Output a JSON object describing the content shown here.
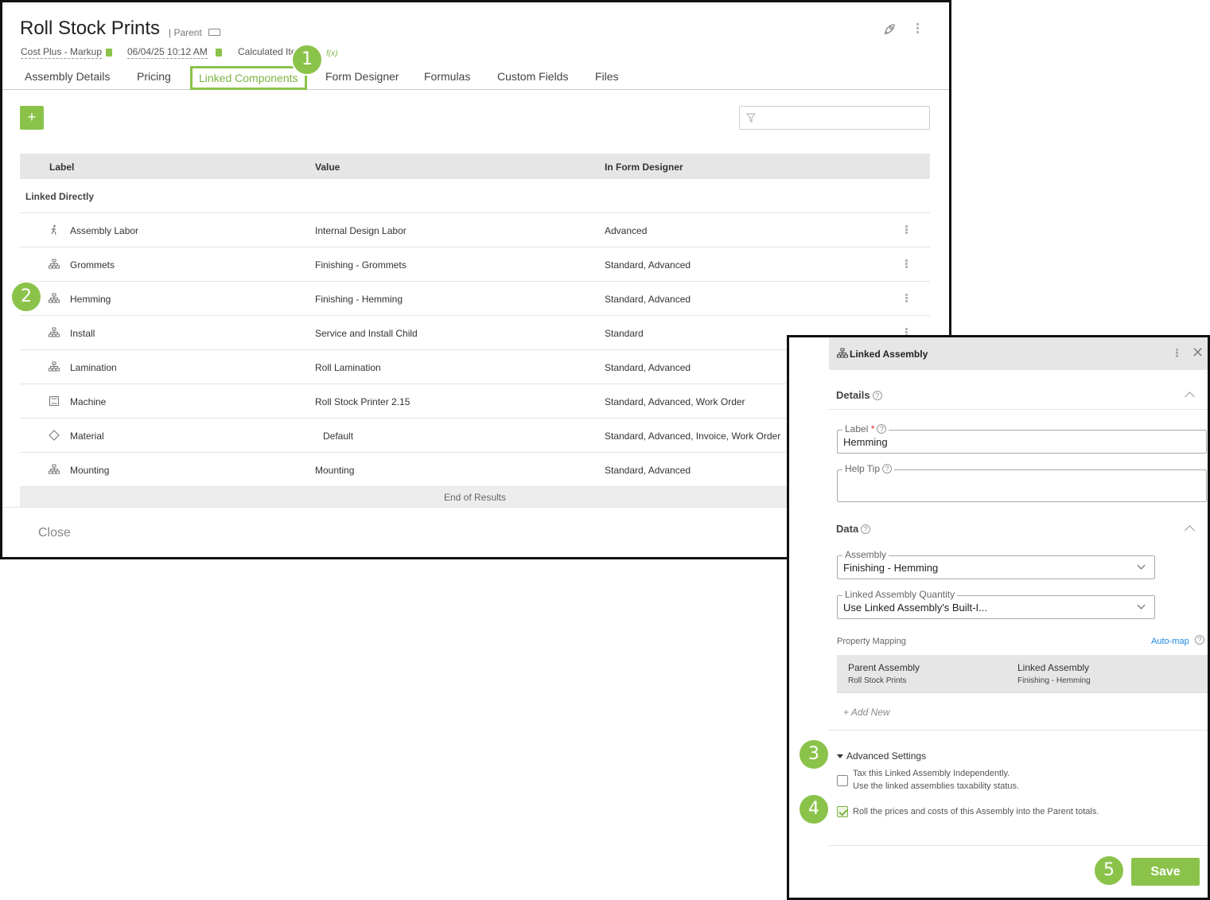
{
  "header": {
    "title": "Roll Stock Prints",
    "parent_tag": "| Parent",
    "pricing_method": "Cost Plus - Markup",
    "timestamp": "06/04/25 10:12 AM",
    "calculated": "Calculated Ite",
    "fx_symbol": "f(x)"
  },
  "tabs": [
    {
      "label": "Assembly Details"
    },
    {
      "label": "Pricing"
    },
    {
      "label": "Linked Components"
    },
    {
      "label": "Form Designer"
    },
    {
      "label": "Formulas"
    },
    {
      "label": "Custom Fields"
    },
    {
      "label": "Files"
    }
  ],
  "toolbar": {
    "add_label": "+"
  },
  "table": {
    "columns": [
      "Label",
      "Value",
      "In Form Designer"
    ],
    "group_label": "Linked Directly",
    "rows": [
      {
        "icon": "person-walking-icon",
        "label": "Assembly Labor",
        "value": "Internal Design Labor",
        "form": "Advanced"
      },
      {
        "icon": "hierarchy-icon",
        "label": "Grommets",
        "value": "Finishing - Grommets",
        "form": "Standard, Advanced"
      },
      {
        "icon": "hierarchy-icon",
        "label": "Hemming",
        "value": "Finishing - Hemming",
        "form": "Standard, Advanced"
      },
      {
        "icon": "hierarchy-icon",
        "label": "Install",
        "value": "Service and Install Child",
        "form": "Standard"
      },
      {
        "icon": "hierarchy-icon",
        "label": "Lamination",
        "value": "Roll Lamination",
        "form": "Standard, Advanced"
      },
      {
        "icon": "machine-icon",
        "label": "Machine",
        "value": "Roll Stock Printer 2.15",
        "form": "Standard, Advanced, Work Order"
      },
      {
        "icon": "diamond-icon",
        "label": "Material",
        "value": "Default",
        "form": "Standard, Advanced, Invoice, Work Order"
      },
      {
        "icon": "hierarchy-icon",
        "label": "Mounting",
        "value": "Mounting",
        "form": "Standard, Advanced"
      }
    ],
    "end_text": "End of Results"
  },
  "footer": {
    "close_label": "Close"
  },
  "panel": {
    "title": "Linked Assembly",
    "details_title": "Details",
    "label_field": {
      "legend": "Label",
      "required": "*",
      "value": "Hemming"
    },
    "helptip_field": {
      "legend": "Help Tip",
      "value": ""
    },
    "data_title": "Data",
    "assembly_field": {
      "legend": "Assembly",
      "value": "Finishing - Hemming"
    },
    "quantity_field": {
      "legend": "Linked Assembly Quantity",
      "value": "Use Linked Assembly's Built-I..."
    },
    "property_mapping": "Property Mapping",
    "auto_map": "Auto-map",
    "mapping": {
      "parent_header": "Parent Assembly",
      "parent_value": "Roll Stock Prints",
      "linked_header": "Linked Assembly",
      "linked_value": "Finishing - Hemming"
    },
    "add_new": "+ Add New",
    "advanced_title": "Advanced Settings",
    "tax_line1": "Tax this Linked Assembly Independently.",
    "tax_line2": "Use the linked assemblies taxability status.",
    "tax_checked": false,
    "roll_text": "Roll the prices and costs of this Assembly into the Parent totals.",
    "roll_checked": true,
    "save_label": "Save"
  },
  "markers": [
    "1",
    "2",
    "3",
    "4",
    "5"
  ],
  "colors": {
    "accent": "#8bc34a",
    "link": "#1e88e5",
    "header_bg": "#e6e6e6"
  }
}
